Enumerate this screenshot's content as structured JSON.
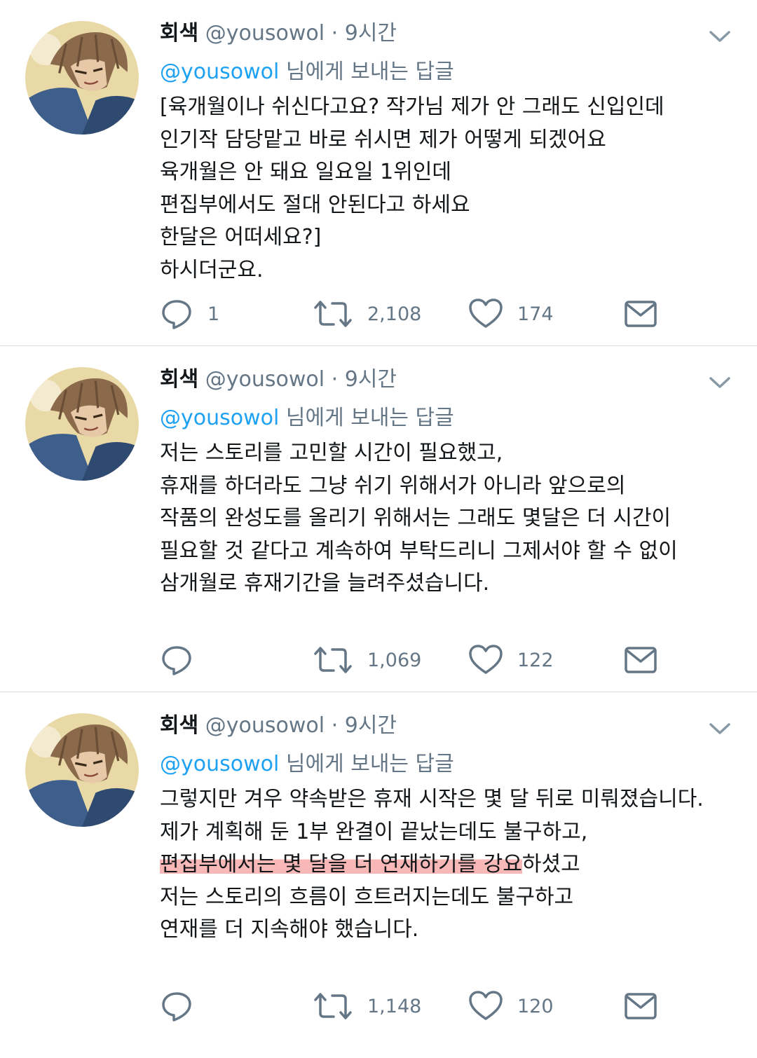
{
  "colors": {
    "mention": "#1da1f2",
    "muted": "#657786",
    "text": "#14171a",
    "highlight": "#f7a0a0"
  },
  "tweets": [
    {
      "name": "회색",
      "handle": "@yousowol",
      "dot": "·",
      "time": "9시간",
      "reply_mention": "@yousowol",
      "reply_suffix": " 님에게 보내는 답글",
      "lines": [
        "[육개월이나 쉬신다고요? 작가님 제가 안 그래도 신입인데",
        "인기작 담당맡고 바로 쉬시면 제가 어떻게 되겠어요",
        "육개월은 안 돼요 일요일 1위인데",
        "편집부에서도 절대 안된다고 하세요",
        "한달은 어떠세요?]",
        "하시더군요."
      ],
      "replies": "1",
      "retweets": "2,108",
      "likes": "174"
    },
    {
      "name": "회색",
      "handle": "@yousowol",
      "dot": "·",
      "time": "9시간",
      "reply_mention": "@yousowol",
      "reply_suffix": " 님에게 보내는 답글",
      "lines": [
        "저는 스토리를 고민할 시간이 필요했고,",
        "휴재를 하더라도 그냥 쉬기 위해서가 아니라 앞으로의",
        "작품의 완성도를 올리기 위해서는 그래도 몇달은 더 시간이",
        "필요할 것 같다고 계속하여 부탁드리니 그제서야 할 수 없이",
        "삼개월로 휴재기간을 늘려주셨습니다."
      ],
      "replies": "",
      "retweets": "1,069",
      "likes": "122"
    },
    {
      "name": "회색",
      "handle": "@yousowol",
      "dot": "·",
      "time": "9시간",
      "reply_mention": "@yousowol",
      "reply_suffix": " 님에게 보내는 답글",
      "lines": [
        "그렇지만 겨우 약속받은 휴재 시작은 몇 달 뒤로 미뤄졌습니다.",
        "제가 계획해 둔 1부 완결이 끝났는데도 불구하고,",
        "편집부에서는 몇 달을 더 연재하기를 강요",
        "하셨고",
        "저는 스토리의 흐름이 흐트러지는데도 불구하고",
        "연재를 더 지속해야 했습니다."
      ],
      "replies": "",
      "retweets": "1,148",
      "likes": "120"
    }
  ]
}
